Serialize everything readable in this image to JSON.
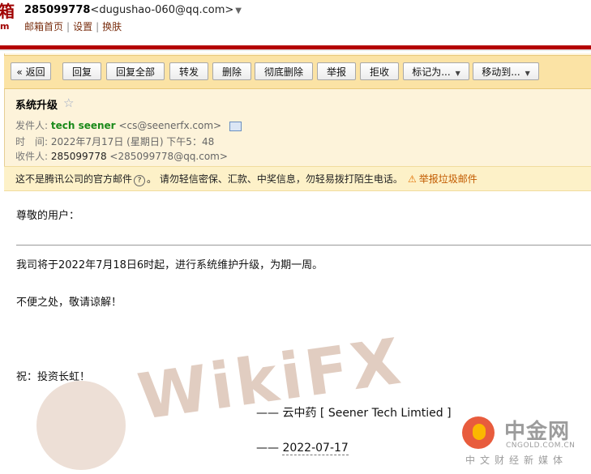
{
  "header": {
    "logo_char": "箱",
    "logo_sub": "m",
    "account_id": "285099778",
    "account_email": "<dugushao-060@qq.com>",
    "account_arrow": "▼",
    "links": [
      "邮箱首页",
      "设置",
      "换肤"
    ],
    "link_sep": "|"
  },
  "toolbar": {
    "back": "« 返回",
    "reply": "回复",
    "reply_all": "回复全部",
    "forward": "转发",
    "delete": "删除",
    "delete_forever": "彻底删除",
    "report": "举报",
    "reject": "拒收",
    "mark_as": "标记为...",
    "move_to": "移动到...",
    "dropdown_glyph": "▼"
  },
  "email": {
    "subject": "系统升级",
    "star": "☆",
    "from_label": "发件人:",
    "from_name": "tech seener",
    "from_email": "<cs@seenerfx.com>",
    "time_label": "时　间:",
    "time_value": "2022年7月17日 (星期日) 下午5：48",
    "to_label": "收件人:",
    "to_name": "285099778",
    "to_email": "<285099778@qq.com>"
  },
  "warning": {
    "text_a": "这不是腾讯公司的官方邮件",
    "q_glyph": "?",
    "text_b": "。 请勿轻信密保、汇款、中奖信息，勿轻易拨打陌生电话。",
    "report_icon": "⚠",
    "report_label": "举报垃圾邮件"
  },
  "content": {
    "greeting": "尊敬的用户：",
    "line1": "我司将于2022年7月18日6时起，进行系统维护升级，为期一周。",
    "line2": "不便之处，敬请谅解！",
    "line3": "祝：投资长虹！",
    "sig_dash": "——",
    "sig_name": "云中药 [ Seener Tech Limtied ]",
    "date_dash": "——",
    "date": "2022-07-17"
  },
  "watermark": {
    "text": "WikiFX"
  },
  "site_logo": {
    "brand": "中金网",
    "url": "CNGOLD.COM.CN",
    "slogan": "中文财经新媒体"
  },
  "colors": {
    "accent_red": "#b40000",
    "toolbar_bg": "#fbe3a5",
    "sender_green": "#1a8a1a",
    "report_orange": "#c25b00"
  }
}
